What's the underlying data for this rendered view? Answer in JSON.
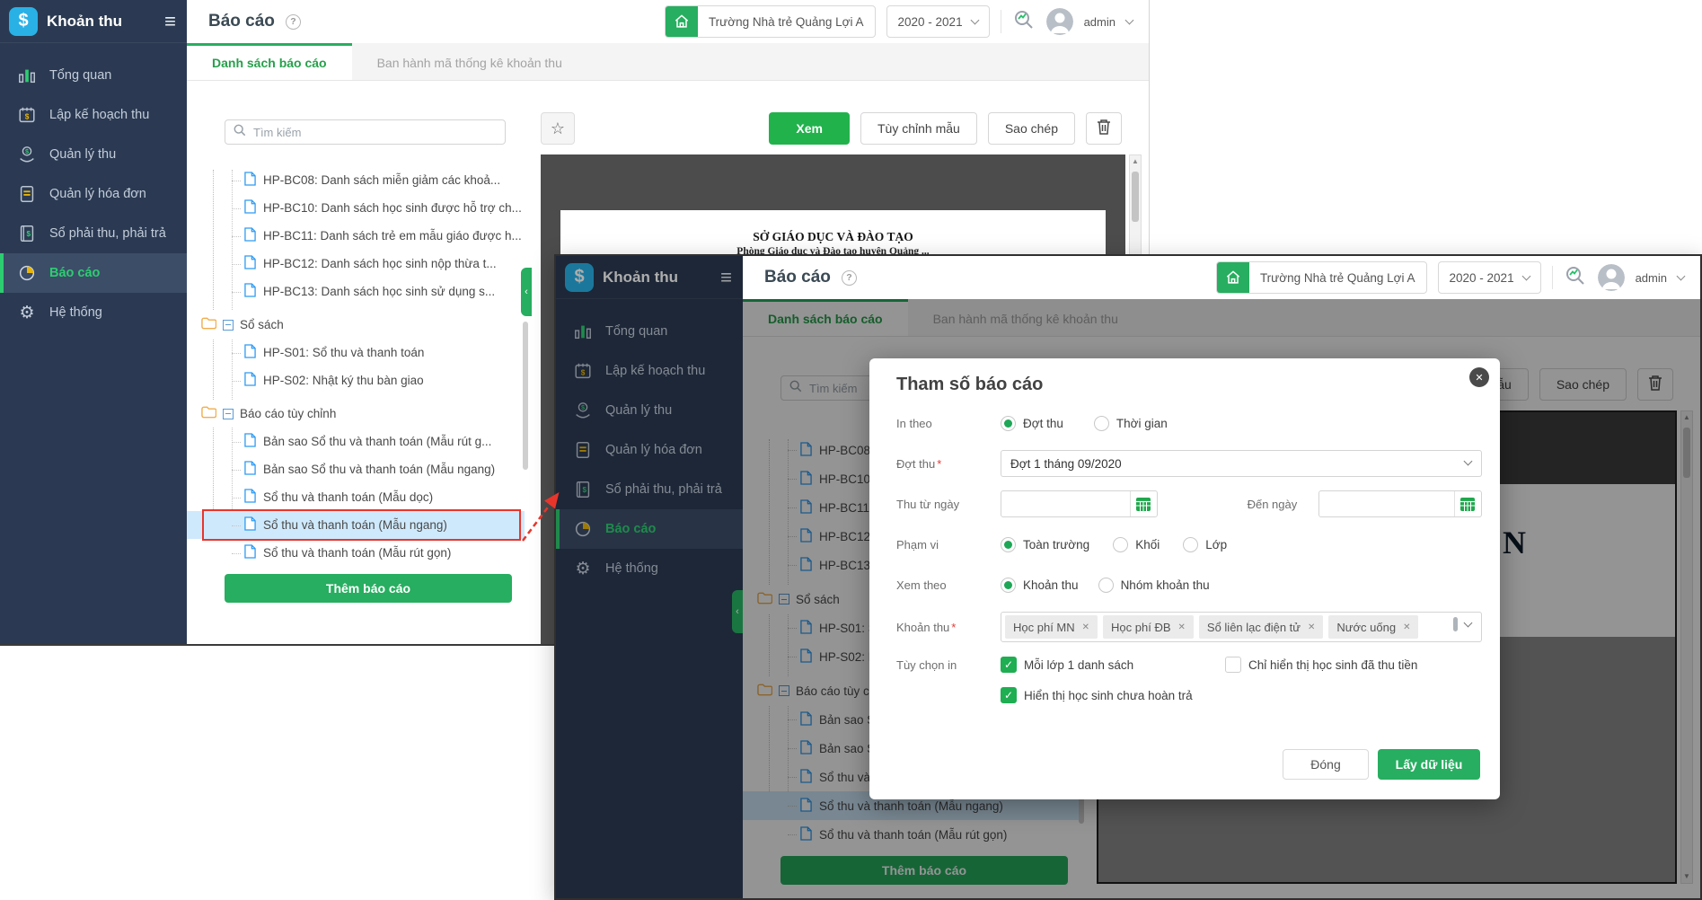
{
  "brand": {
    "app_name": "Khoản thu"
  },
  "icons": {
    "logo": "$",
    "hamburger": "≡",
    "help": "?",
    "star": "☆",
    "gear": "⚙",
    "close": "✕",
    "check": "✓",
    "tag_remove": "✕",
    "collapse": "‹",
    "scroll_up": "▲",
    "scroll_down": "▼"
  },
  "sidebar": {
    "items": [
      {
        "label": "Tổng quan",
        "active": false
      },
      {
        "label": "Lập kế hoạch thu",
        "active": false
      },
      {
        "label": "Quản lý thu",
        "active": false
      },
      {
        "label": "Quản lý hóa đơn",
        "active": false
      },
      {
        "label": "Sổ phải thu, phải trả",
        "active": false
      },
      {
        "label": "Báo cáo",
        "active": true
      },
      {
        "label": "Hệ thống",
        "active": false
      }
    ]
  },
  "header": {
    "page_title": "Báo cáo",
    "school_name": "Trường Nhà trẻ Quảng Lợi A",
    "school_year": "2020 - 2021",
    "username": "admin"
  },
  "tabs": [
    {
      "label": "Danh sách báo cáo",
      "active": true
    },
    {
      "label": "Ban hành mã thống kê khoản thu",
      "active": false
    }
  ],
  "report_panel": {
    "search_placeholder": "Tìm kiếm",
    "add_report_button": "Thêm báo cáo",
    "tree": [
      {
        "type": "file",
        "label": "HP-BC08: Danh sách miễn giảm các khoả..."
      },
      {
        "type": "file",
        "label": "HP-BC10: Danh sách học sinh được hỗ trợ ch..."
      },
      {
        "type": "file",
        "label": "HP-BC11: Danh sách trẻ em mẫu giáo được h..."
      },
      {
        "type": "file",
        "label": "HP-BC12: Danh sách học sinh nộp thừa t..."
      },
      {
        "type": "file",
        "label": "HP-BC13: Danh sách học sinh sử dụng s..."
      },
      {
        "type": "folder",
        "label": "Sổ sách"
      },
      {
        "type": "file",
        "label": "HP-S01: Sổ thu và thanh toán"
      },
      {
        "type": "file",
        "label": "HP-S02: Nhật ký thu bàn giao"
      },
      {
        "type": "folder",
        "label": "Báo cáo tùy chỉnh"
      },
      {
        "type": "file",
        "label": "Bản sao Sổ thu và thanh toán (Mẫu rút g..."
      },
      {
        "type": "file",
        "label": "Bản sao Sổ thu và thanh toán (Mẫu ngang)"
      },
      {
        "type": "file",
        "label": "Sổ thu và thanh toán (Mẫu dọc)"
      },
      {
        "type": "file",
        "label": "Sổ thu và thanh toán (Mẫu ngang)",
        "selected": true,
        "highlighted": true
      },
      {
        "type": "file",
        "label": "Sổ thu và thanh toán (Mẫu rút gọn)"
      }
    ]
  },
  "toolbar": {
    "view": "Xem",
    "customize": "Tùy chỉnh mẫu",
    "copy": "Sao chép"
  },
  "preview": {
    "doc_line1": "SỞ GIÁO DỤC VÀ ĐÀO TẠO",
    "doc_line2": "Phòng Giáo dục và Đào tạo huyện Quảng ...",
    "fragment": "N"
  },
  "modal": {
    "title": "Tham số báo cáo",
    "print_by": {
      "label": "In theo",
      "options": [
        {
          "label": "Đợt thu",
          "selected": true
        },
        {
          "label": "Thời gian",
          "selected": false
        }
      ]
    },
    "collection_period": {
      "label": "Đợt thu",
      "required": "*",
      "value": "Đợt 1 tháng 09/2020"
    },
    "from_date": {
      "label": "Thu từ ngày",
      "value": ""
    },
    "to_date": {
      "label": "Đến ngày",
      "value": ""
    },
    "scope": {
      "label": "Phạm vi",
      "options": [
        {
          "label": "Toàn trường",
          "selected": true
        },
        {
          "label": "Khối",
          "selected": false
        },
        {
          "label": "Lớp",
          "selected": false
        }
      ]
    },
    "view_by": {
      "label": "Xem theo",
      "options": [
        {
          "label": "Khoản thu",
          "selected": true
        },
        {
          "label": "Nhóm khoản thu",
          "selected": false
        }
      ]
    },
    "fees": {
      "label": "Khoản thu",
      "required": "*",
      "tags": [
        "Học phí MN",
        "Học phí ĐB",
        "Sổ liên lạc điện tử",
        "Nước uống"
      ]
    },
    "print_options": {
      "label": "Tùy chọn in",
      "checkboxes": [
        {
          "label": "Mỗi lớp 1 danh sách",
          "checked": true
        },
        {
          "label": "Chỉ hiển thị học sinh đã thu tiền",
          "checked": false
        },
        {
          "label": "Hiển thị học sinh chưa hoàn trả",
          "checked": true
        }
      ]
    },
    "close_button": "Đóng",
    "submit_button": "Lấy dữ liệu"
  }
}
